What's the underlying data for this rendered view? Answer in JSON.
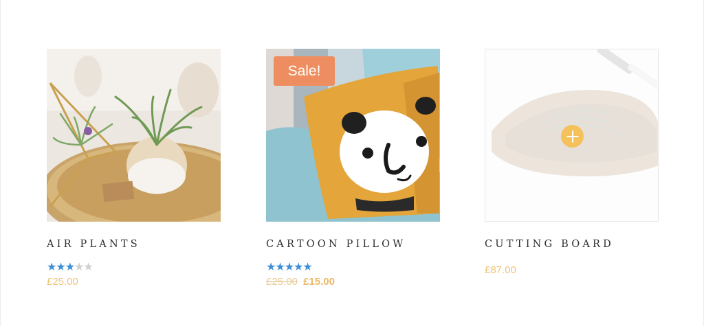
{
  "colors": {
    "star_filled": "#3b8fd6",
    "star_empty": "#cfcfcf",
    "price": "#ecc57a",
    "sale_badge": "#ee8e60",
    "add_circle": "#f4c15a"
  },
  "products": [
    {
      "name": "AIR PLANTS",
      "image": "air-plants-photo",
      "rating": 3,
      "rating_max": 5,
      "price": "£25.00"
    },
    {
      "name": "CARTOON PILLOW",
      "image": "cartoon-pillow-photo",
      "badge": "Sale!",
      "rating": 5,
      "rating_max": 5,
      "price_old": "£25.00",
      "price": "£15.00"
    },
    {
      "name": "CUTTING BOARD",
      "image": "cutting-board-photo",
      "add_icon": "plus-circle-icon",
      "price": "£87.00"
    }
  ]
}
